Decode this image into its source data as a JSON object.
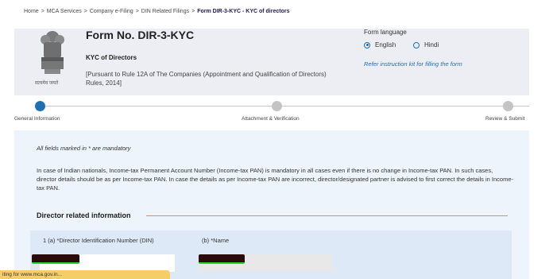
{
  "breadcrumb": {
    "items": [
      "Home",
      "MCA Services",
      "Company e-Filing",
      "DIN Related Filings"
    ],
    "current": "Form DIR-3-KYC - KYC of directors",
    "separator": ">"
  },
  "header": {
    "emblem_text": "सत्यमेव जयते",
    "form_title": "Form No. DIR-3-KYC",
    "form_subtitle": "KYC of Directors",
    "form_description": "[Pursuant to Rule 12A of The Companies (Appointment and Qualification of Directors) Rules, 2014]",
    "language": {
      "label": "Form language",
      "options": [
        "English",
        "Hindi"
      ],
      "selected": "English"
    },
    "instruction_link": "Refer instruction kit for filling the form"
  },
  "stepper": {
    "steps": [
      "General Information",
      "Attachment & Verification",
      "Review & Submit"
    ],
    "active_index": 0
  },
  "content": {
    "mandatory_note": "All fields marked in  * are mandatory",
    "info_paragraph": "In case of Indian nationals, Income-tax Permanent Account Number (Income-tax PAN) is mandatory in all cases even if there is no change in Income-tax PAN. In such cases, director details should be as per Income-tax PAN. In case the details as per Income-tax PAN are incorrect, director/designated partner is advised to first correct the details in Income-tax PAN.",
    "section_title": "Director related information",
    "fields": {
      "din_label": "1 (a) *Director Identification Number (DIN)",
      "name_label": "(b) *Name"
    }
  },
  "status_bar": "iting for www.mca.gov.in...",
  "colors": {
    "accent": "#1f6fb2",
    "header_bg": "#eceef3",
    "content_bg": "#edf4fc",
    "section_rule": "#e4876b",
    "status_bar": "#f5ce6a"
  }
}
